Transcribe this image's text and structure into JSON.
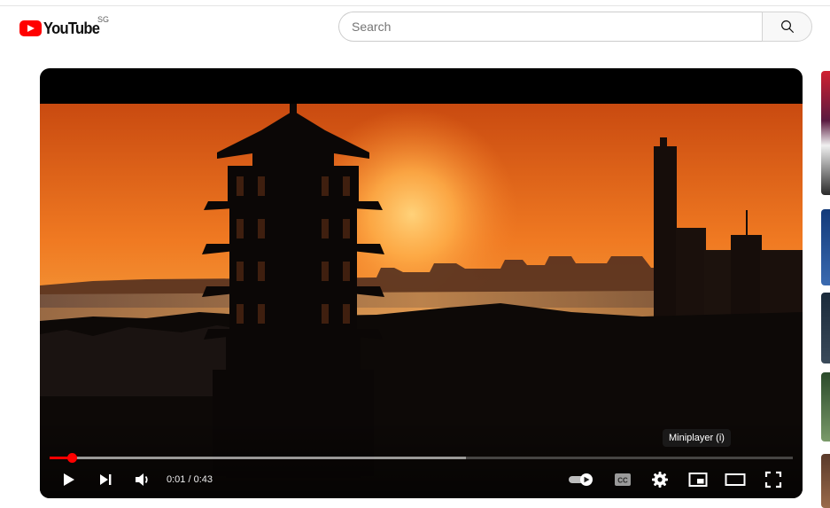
{
  "header": {
    "logo_text": "YouTube",
    "region": "SG",
    "search": {
      "placeholder": "Search",
      "value": ""
    }
  },
  "player": {
    "time_current": "0:01",
    "time_separator": " / ",
    "time_total": "0:43",
    "progress": {
      "played_fraction": 0.03,
      "buffered_fraction": 0.56
    },
    "tooltip": "Miniplayer (i)",
    "autoplay_on": true
  },
  "colors": {
    "brand_red": "#ff0000",
    "player_bg": "#000000"
  },
  "icons": {
    "search": "search-icon",
    "play": "play-icon",
    "next": "next-icon",
    "volume": "volume-icon",
    "autoplay": "autoplay-toggle-icon",
    "captions": "captions-icon",
    "settings": "gear-icon",
    "miniplayer": "miniplayer-icon",
    "theater": "theater-mode-icon",
    "fullscreen": "fullscreen-icon"
  }
}
